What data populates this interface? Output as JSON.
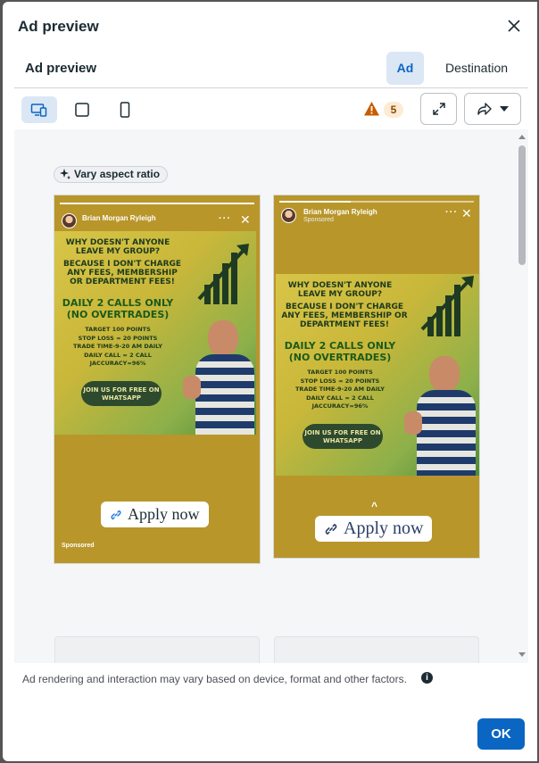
{
  "dialog": {
    "title": "Ad preview",
    "subtitle": "Ad preview",
    "tabs": [
      {
        "label": "Ad",
        "active": true
      },
      {
        "label": "Destination",
        "active": false
      }
    ],
    "warning_count": "5",
    "vary_aspect_ratio": "Vary aspect ratio",
    "footnote": "Ad rendering and interaction may vary based on device, format and other factors.",
    "ok_label": "OK",
    "accent_color": "#0a66c2",
    "warning_color": "#c75c00"
  },
  "device_toolbar": [
    "desktop-and-mobile-icon",
    "square-icon",
    "phone-icon"
  ],
  "previews": [
    {
      "page_name": "Brian Morgan Ryleigh",
      "sponsored": "Sponsored",
      "cta": "Apply now",
      "creative": {
        "headline": "WHY DOESN'T ANYONE LEAVE MY GROUP?",
        "subhead": "BECAUSE I DON'T CHARGE ANY FEES, MEMBERSHIP OR DEPARTMENT FEES!",
        "offer": "DAILY 2 CALLS ONLY (NO OVERTRADES)",
        "details": [
          "TARGET 100 POINTS",
          "STOP LOSS = 20 POINTS",
          "TRADE TIME-9-20 AM DAILY",
          "DAILY CALL = 2 CALL",
          "JACCURACY=96%"
        ],
        "join": "JOIN US FOR FREE ON WHATSAPP"
      }
    },
    {
      "page_name": "Brian Morgan Ryleigh",
      "sponsored": "Sponsored",
      "cta": "Apply now",
      "creative": {
        "headline": "WHY DOESN'T ANYONE LEAVE MY GROUP?",
        "subhead": "BECAUSE I DON'T CHARGE ANY FEES, MEMBERSHIP OR DEPARTMENT FEES!",
        "offer": "DAILY 2 CALLS ONLY (NO OVERTRADES)",
        "details": [
          "TARGET 100 POINTS",
          "STOP LOSS = 20 POINTS",
          "TRADE TIME-9-20 AM DAILY",
          "DAILY CALL = 2 CALL",
          "JACCURACY=96%"
        ],
        "join": "JOIN US FOR FREE ON WHATSAPP"
      }
    }
  ]
}
